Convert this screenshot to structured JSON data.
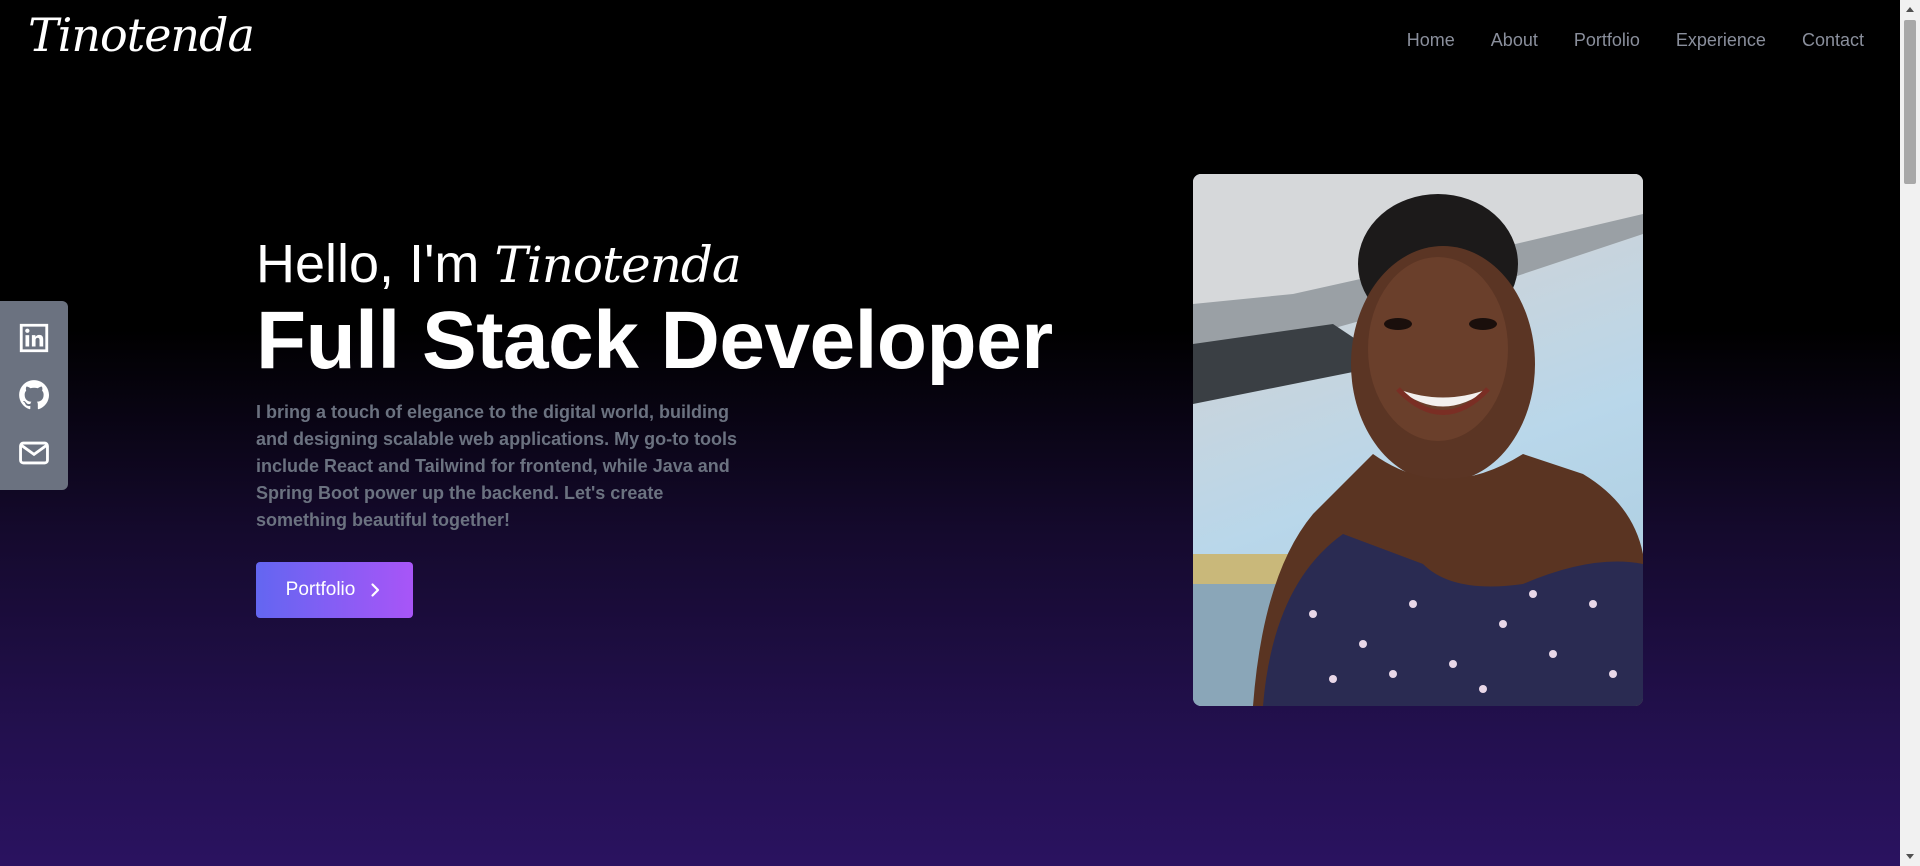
{
  "header": {
    "logo": "Tinotenda",
    "nav": [
      "Home",
      "About",
      "Portfolio",
      "Experience",
      "Contact"
    ]
  },
  "social": {
    "icons": [
      "linkedin-icon",
      "github-icon",
      "mail-icon"
    ]
  },
  "hero": {
    "greeting": "Hello, I'm",
    "name": "Tinotenda",
    "role": "Full Stack Developer",
    "description": "I bring a touch of elegance to the digital world, building and designing scalable web applications. My go-to tools include React and Tailwind for frontend, while Java and Spring Boot power up the backend. Let's create something beautiful together!",
    "cta_label": "Portfolio"
  },
  "colors": {
    "accent_start": "#6366f1",
    "accent_end": "#a855f7",
    "nav_text": "#8a8f9c",
    "body_text": "#6b7280",
    "sidebar_bg": "#6b7280"
  }
}
